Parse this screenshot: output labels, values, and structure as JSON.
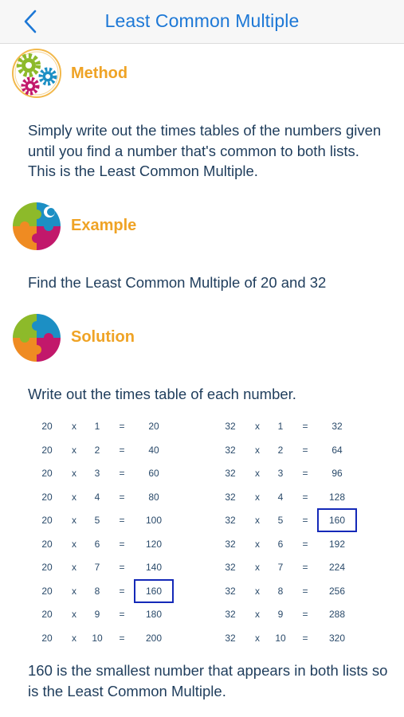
{
  "nav": {
    "title": "Least Common Multiple"
  },
  "sections": [
    {
      "heading": "Method",
      "icon": "gears-icon"
    },
    {
      "heading": "Example",
      "icon": "puzzle-icon"
    },
    {
      "heading": "Solution",
      "icon": "puzzle-icon"
    }
  ],
  "method_text": "Simply write out the times tables of the numbers given until you find a number that's common to both lists. This is the Least Common Multiple.",
  "example_text": "Find the Least Common Multiple of 20 and 32",
  "solution_intro": "Write out the times table of each number.",
  "table_left": {
    "base": "20",
    "rows": [
      [
        "20",
        "x",
        "1",
        "=",
        "20"
      ],
      [
        "20",
        "x",
        "2",
        "=",
        "40"
      ],
      [
        "20",
        "x",
        "3",
        "=",
        "60"
      ],
      [
        "20",
        "x",
        "4",
        "=",
        "80"
      ],
      [
        "20",
        "x",
        "5",
        "=",
        "100"
      ],
      [
        "20",
        "x",
        "6",
        "=",
        "120"
      ],
      [
        "20",
        "x",
        "7",
        "=",
        "140"
      ],
      [
        "20",
        "x",
        "8",
        "=",
        "160"
      ],
      [
        "20",
        "x",
        "9",
        "=",
        "180"
      ],
      [
        "20",
        "x",
        "10",
        "=",
        "200"
      ]
    ],
    "highlight_row": 7
  },
  "table_right": {
    "base": "32",
    "rows": [
      [
        "32",
        "x",
        "1",
        "=",
        "32"
      ],
      [
        "32",
        "x",
        "2",
        "=",
        "64"
      ],
      [
        "32",
        "x",
        "3",
        "=",
        "96"
      ],
      [
        "32",
        "x",
        "4",
        "=",
        "128"
      ],
      [
        "32",
        "x",
        "5",
        "=",
        "160"
      ],
      [
        "32",
        "x",
        "6",
        "=",
        "192"
      ],
      [
        "32",
        "x",
        "7",
        "=",
        "224"
      ],
      [
        "32",
        "x",
        "8",
        "=",
        "256"
      ],
      [
        "32",
        "x",
        "9",
        "=",
        "288"
      ],
      [
        "32",
        "x",
        "10",
        "=",
        "320"
      ]
    ],
    "highlight_row": 4
  },
  "conclusion": "160 is the smallest number that appears in both lists so is the Least Common Multiple.",
  "colors": {
    "nav_title": "#1d78d6",
    "heading": "#efa325",
    "highlight_box": "#1429b8",
    "text": "#1f3d5c"
  }
}
